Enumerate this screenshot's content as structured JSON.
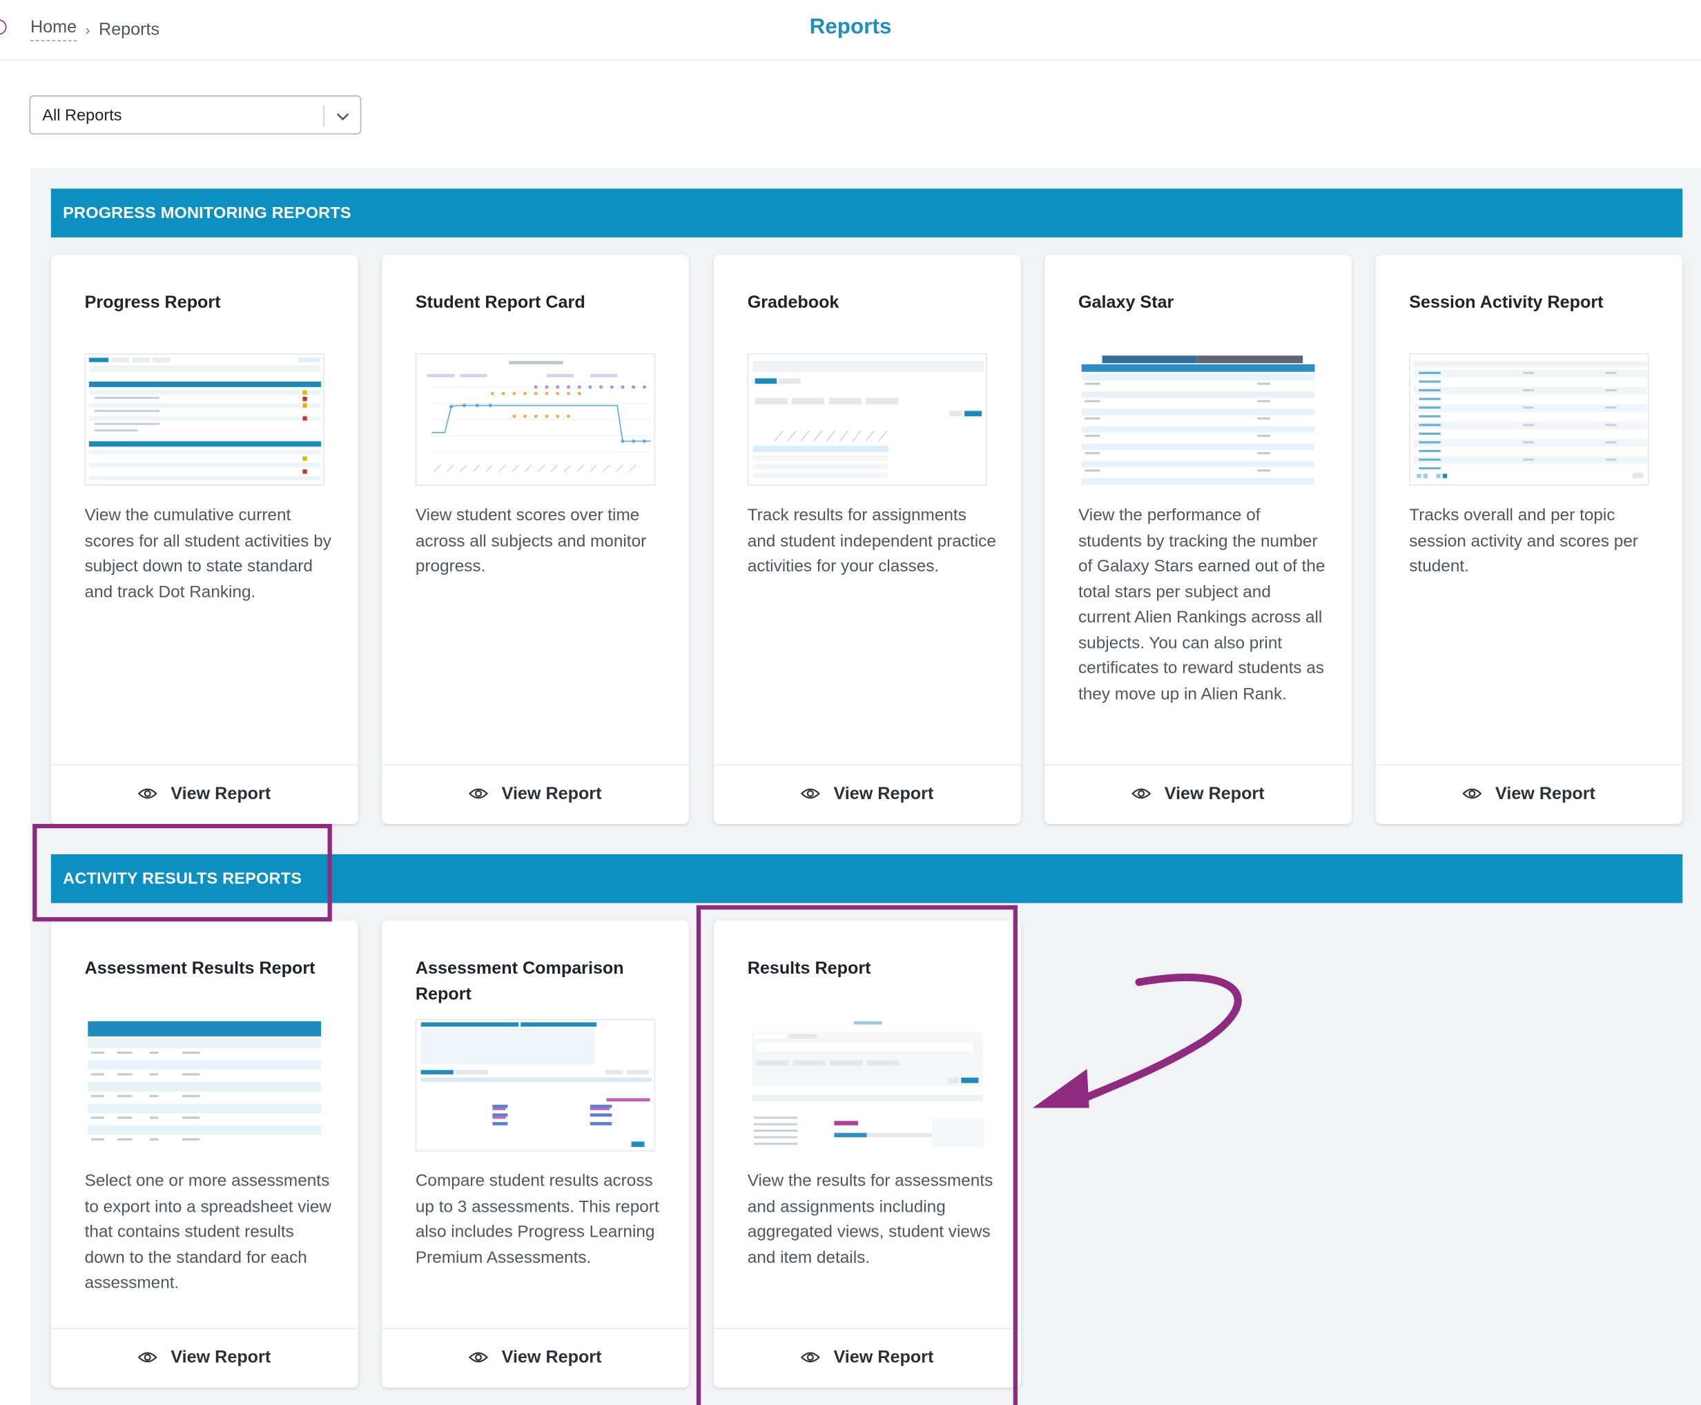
{
  "breadcrumb": {
    "home": "Home",
    "separator": "›",
    "current": "Reports"
  },
  "page_title": "Reports",
  "filter": {
    "selected": "All Reports"
  },
  "sections": [
    {
      "label": "PROGRESS MONITORING REPORTS",
      "cards": [
        {
          "title": "Progress Report",
          "description": "View the cumulative current scores for all student activities by subject down to state standard and track Dot Ranking.",
          "action": "View Report"
        },
        {
          "title": "Student Report Card",
          "description": "View student scores over time across all subjects and monitor progress.",
          "action": "View Report"
        },
        {
          "title": "Gradebook",
          "description": "Track results for assignments and student independent practice activities for your classes.",
          "action": "View Report"
        },
        {
          "title": "Galaxy Star",
          "description": "View the performance of students by tracking the number of Galaxy Stars earned out of the total stars per subject and current Alien Rankings across all subjects. You can also print certificates to reward students as they move up in Alien Rank.",
          "action": "View Report"
        },
        {
          "title": "Session Activity Report",
          "description": "Tracks overall and per topic session activity and scores per student.",
          "action": "View Report"
        }
      ]
    },
    {
      "label": "ACTIVITY RESULTS REPORTS",
      "cards": [
        {
          "title": "Assessment Results Report",
          "description": "Select one or more assessments to export into a spreadsheet view that contains student results down to the standard for each assessment.",
          "action": "View Report"
        },
        {
          "title": "Assessment Comparison Report",
          "description": "Compare student results across up to 3 assessments. This report also includes Progress Learning Premium Assessments.",
          "action": "View Report"
        },
        {
          "title": "Results Report",
          "description": "View the results for assessments and assignments including aggregated views, student views and item details.",
          "action": "View Report"
        }
      ]
    }
  ],
  "colors": {
    "accent": "#0c90c2",
    "title_blue": "#1f8fc1",
    "annotation": "#8e2a80",
    "page_bg": "#f2f3f5"
  }
}
